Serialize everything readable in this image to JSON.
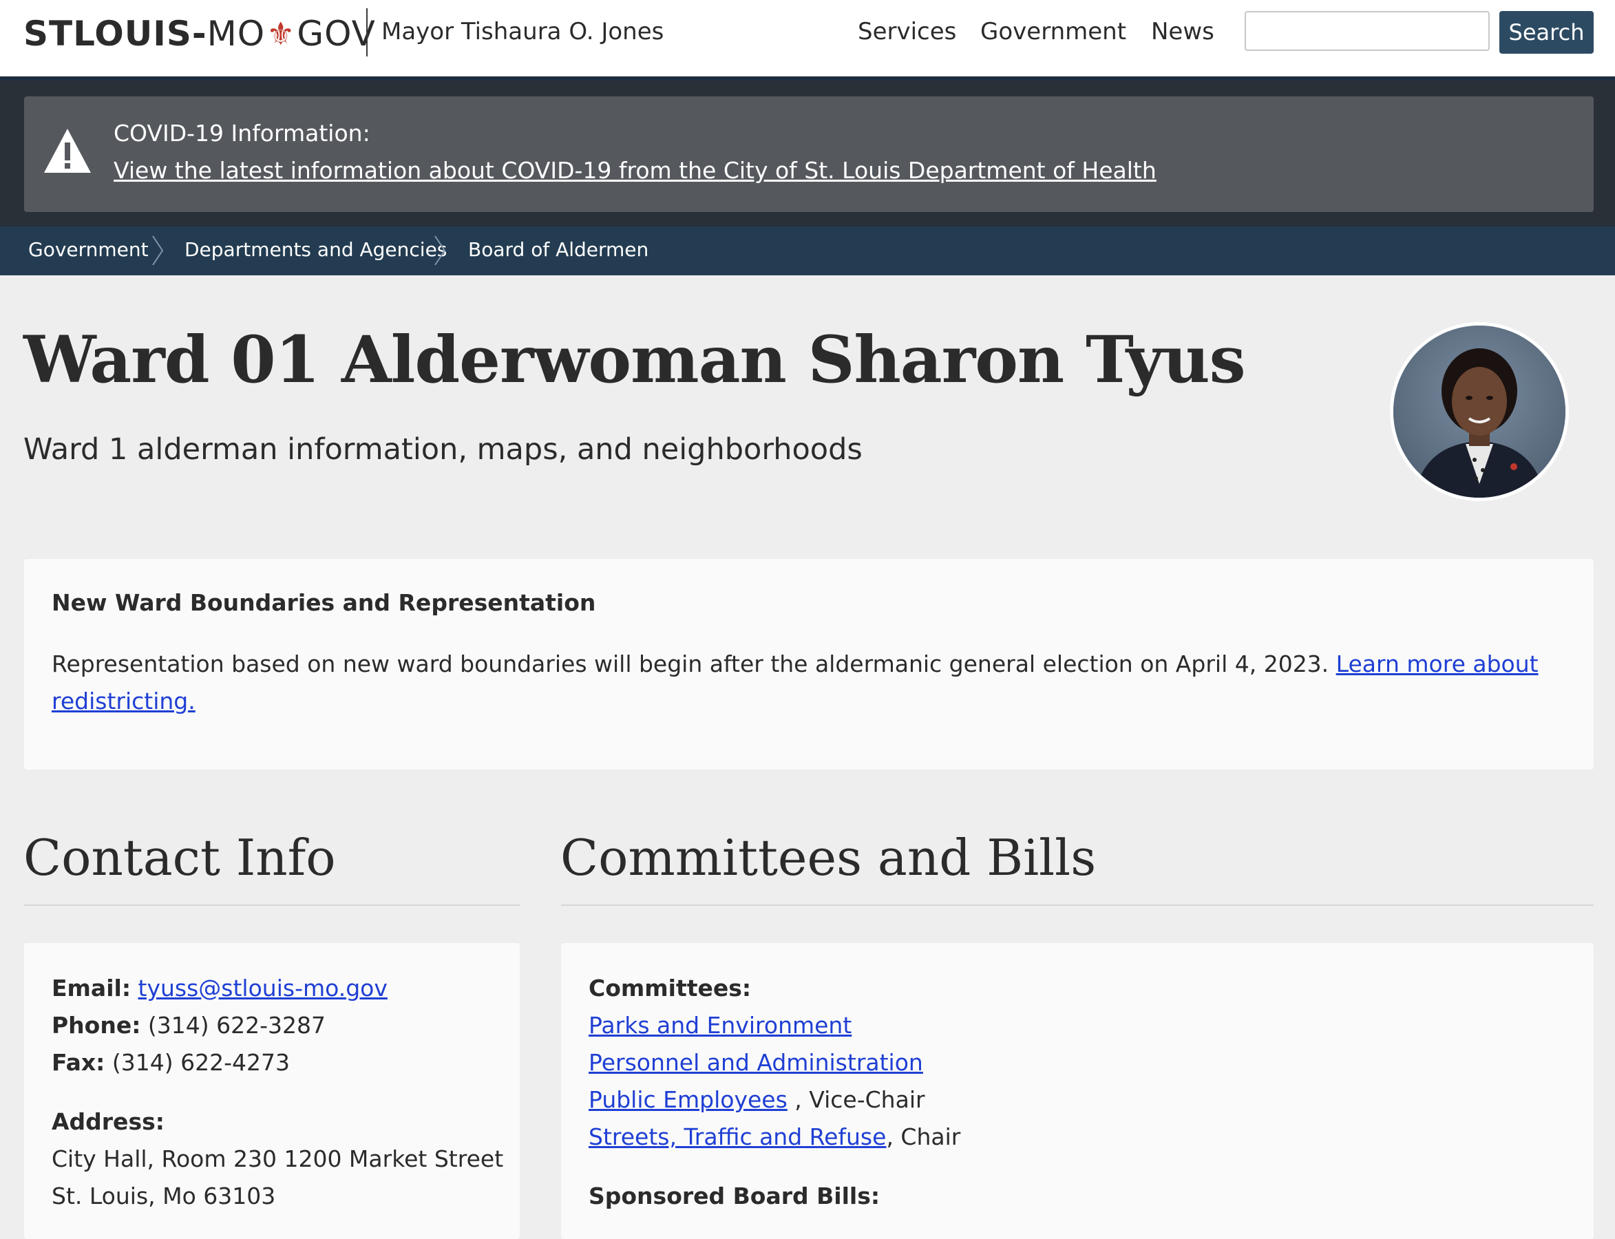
{
  "header": {
    "logo": {
      "part1": "STLOUIS-",
      "part2": "MO",
      "fleur": "⚜",
      "part3": "GOV"
    },
    "mayor": "Mayor Tishaura O. Jones",
    "nav": [
      "Services",
      "Government",
      "News"
    ],
    "search": {
      "placeholder": "",
      "button": "Search"
    }
  },
  "alert": {
    "icon": "warning-icon",
    "title": "COVID-19 Information:",
    "link": "View the latest information about COVID-19 from the City of St. Louis Department of Health"
  },
  "breadcrumb": [
    "Government",
    "Departments and Agencies",
    "Board of Aldermen"
  ],
  "hero": {
    "title": "Ward 01 Alderwoman Sharon Tyus",
    "subtitle": "Ward 1 alderman information, maps, and neighborhoods"
  },
  "notice": {
    "heading": "New Ward Boundaries and Representation",
    "body": "Representation based on new ward boundaries will begin after the aldermanic general election on April 4, 2023. ",
    "link": "Learn more about redistricting."
  },
  "contact": {
    "heading": "Contact Info",
    "email_label": "Email:",
    "email": "tyuss@stlouis-mo.gov",
    "phone_label": "Phone:",
    "phone": "(314) 622-3287",
    "fax_label": "Fax:",
    "fax": "(314) 622-4273",
    "address_label": "Address:",
    "address_line1": "City Hall, Room 230 1200 Market Street",
    "address_line2": "St. Louis, Mo 63103"
  },
  "committees": {
    "heading": "Committees and Bills",
    "committees_label": "Committees:",
    "items": [
      {
        "name": "Parks and Environment",
        "role": ""
      },
      {
        "name": "Personnel and Administration",
        "role": ""
      },
      {
        "name": "Public Employees",
        "role": " , Vice-Chair"
      },
      {
        "name": "Streets, Traffic and Refuse",
        "role": ", Chair"
      }
    ],
    "bills_label": "Sponsored Board Bills:"
  },
  "colors": {
    "header_bg": "#ffffff",
    "alert_band": "#2a3038",
    "alert_box": "#55595e",
    "breadcrumb_bg": "#233c51",
    "search_button": "#2d4a63",
    "link": "#1f3fd4",
    "fleur": "#c0392b",
    "page_bg": "#eeeeee"
  }
}
